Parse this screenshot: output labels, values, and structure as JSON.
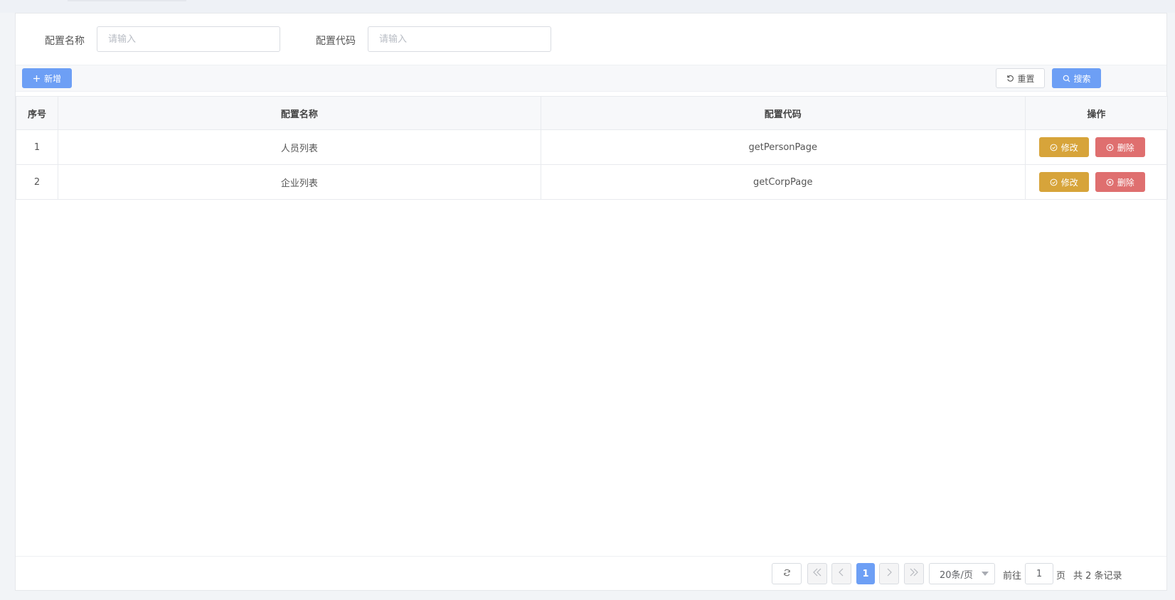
{
  "search": {
    "name_label": "配置名称",
    "name_placeholder": "请输入",
    "code_label": "配置代码",
    "code_placeholder": "请输入"
  },
  "toolbar": {
    "add_label": "新增",
    "reset_label": "重置",
    "search_label": "搜索"
  },
  "table": {
    "columns": [
      "序号",
      "配置名称",
      "配置代码",
      "操作"
    ],
    "rows": [
      {
        "index": "1",
        "name": "人员列表",
        "code": "getPersonPage"
      },
      {
        "index": "2",
        "name": "企业列表",
        "code": "getCorpPage"
      }
    ],
    "edit_label": "修改",
    "delete_label": "删除"
  },
  "pagination": {
    "current_page": "1",
    "page_size": "20条/页",
    "goto_prefix": "前往",
    "goto_value": "1",
    "goto_suffix": "页",
    "total_text": "共 2 条记录"
  },
  "colors": {
    "primary": "#6d9ff5",
    "warning": "#d7a43a",
    "danger": "#df6f6f"
  }
}
